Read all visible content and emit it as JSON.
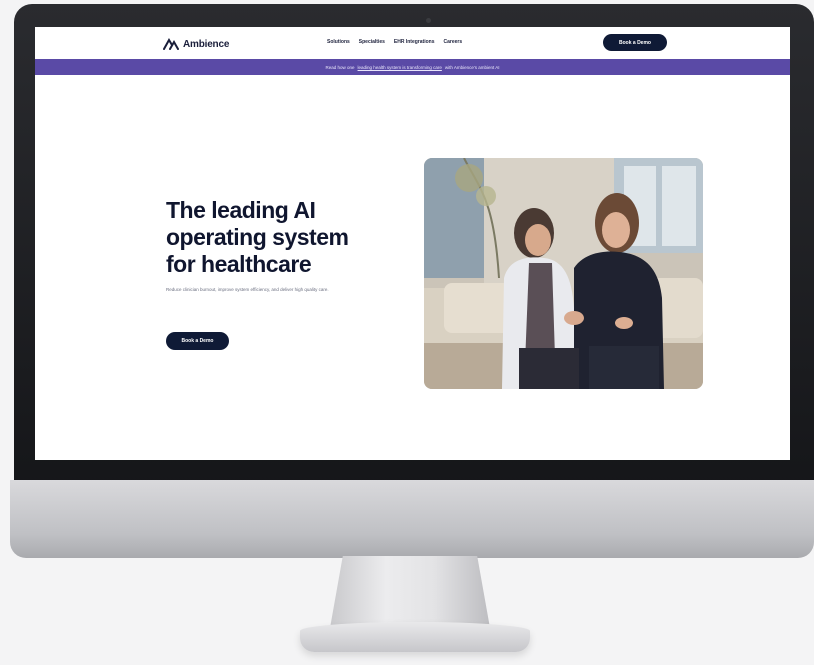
{
  "site": {
    "brand": "Ambience",
    "nav": [
      {
        "label": "Solutions"
      },
      {
        "label": "Specialties"
      },
      {
        "label": "EHR Integrations"
      },
      {
        "label": "Careers"
      }
    ],
    "cta_label": "Book a Demo"
  },
  "announcement": {
    "prefix": "Read how one",
    "link": "leading health system is transforming care",
    "suffix": "with Ambience's ambient AI"
  },
  "hero": {
    "title_lines": [
      "The leading AI",
      "operating system",
      "for healthcare"
    ],
    "subtitle": "Reduce clinician burnout, improve system efficiency, and deliver high quality care.",
    "cta_label": "Book a Demo"
  },
  "icons": {
    "logo": "ambience-logo-icon",
    "photo": "clinician-patient-photo"
  },
  "colors": {
    "announcement_bg": "#5a4aa6",
    "button_bg": "#0f1a36",
    "title_text": "#10162f"
  }
}
